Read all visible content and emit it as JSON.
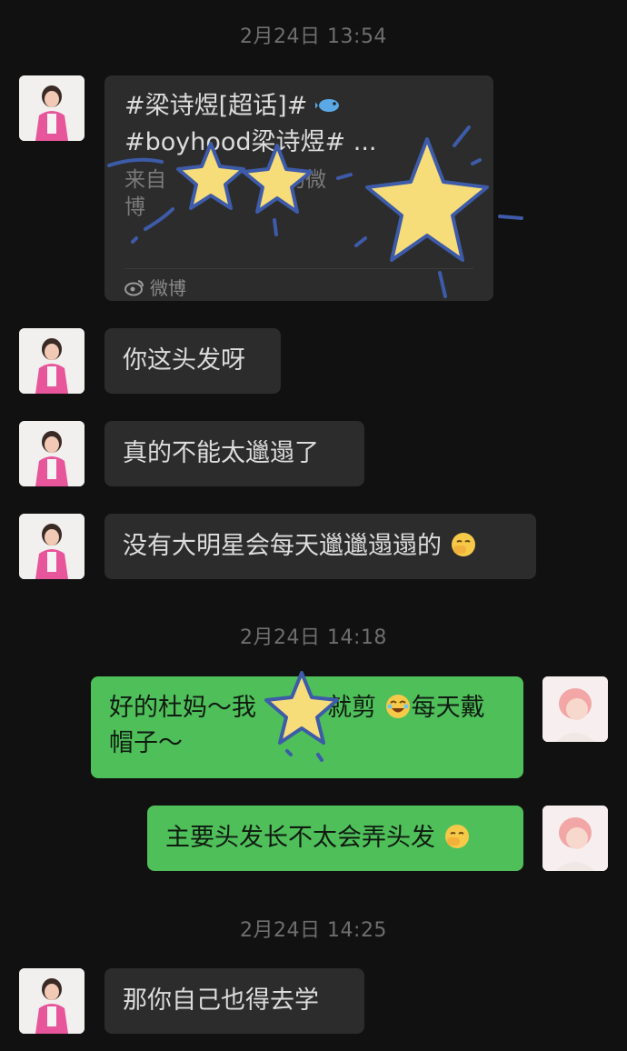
{
  "messages": {
    "ts1": "2月24日 13:54",
    "card_line1": "#梁诗煜[超话]# ",
    "card_line2": "#boyhood梁诗煜# ...",
    "card_desc": "来自",
    "card_desc2": "的微",
    "card_desc3": "博",
    "card_source": "微博",
    "msg1": "你这头发呀",
    "msg2": "真的不能太邋遢了",
    "msg3": "没有大明星会每天邋邋遢遢的",
    "ts2": "2月24日 14:18",
    "msg4_a": "好的杜妈～我",
    "msg4_b": "就剪",
    "msg4_c": "每天戴",
    "msg4_d": "帽子～",
    "msg5": "主要头发长不太会弄头发",
    "ts3": "2月24日 14:25",
    "msg6": "那你自己也得去学"
  },
  "icons": [
    "fish-emoji",
    "weibo-icon",
    "facepalm-emoji",
    "laughing-emoji",
    "sticker-star"
  ],
  "colors": {
    "background": "#111111",
    "incoming_bubble": "#2c2c2c",
    "outgoing_bubble": "#4fbf5a",
    "star": "#f7dc7a",
    "star_outline": "#3d5ba8"
  }
}
